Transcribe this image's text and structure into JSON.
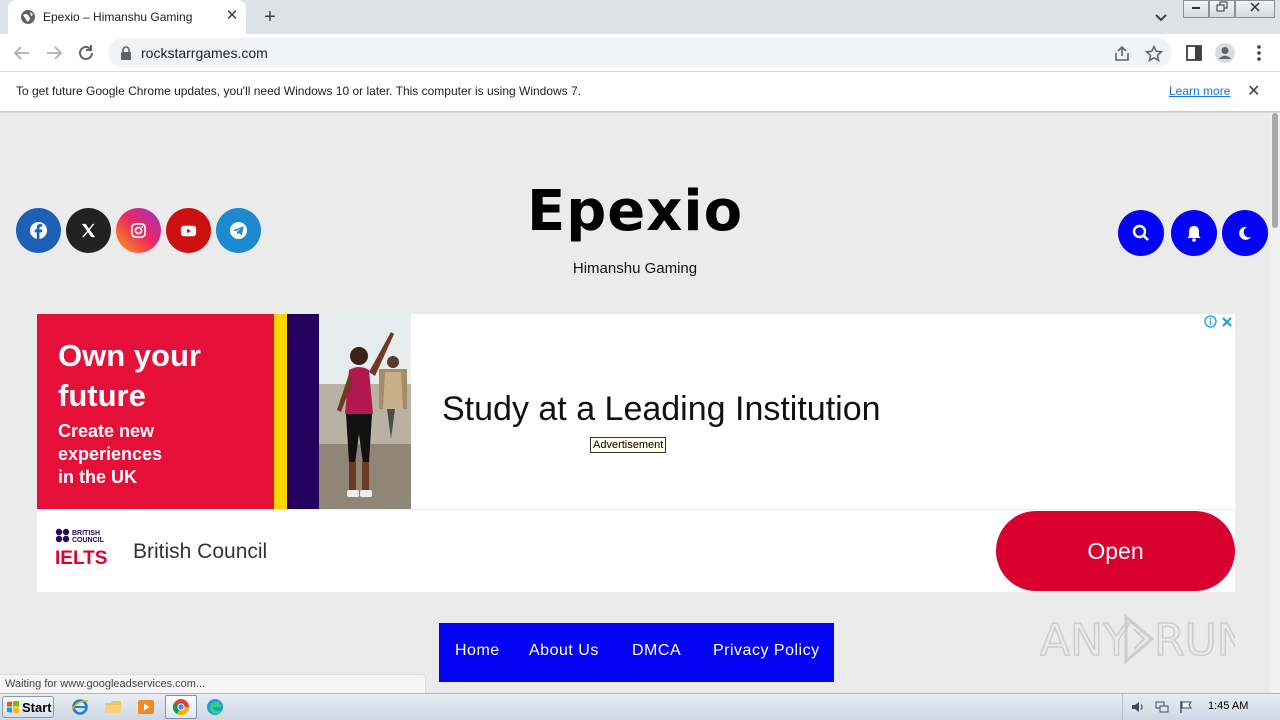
{
  "browser": {
    "tab_title": "Epexio – Himanshu Gaming",
    "tab_close": "✕",
    "new_tab": "+",
    "url": "rockstarrgames.com"
  },
  "infobar": {
    "message": "To get future Google Chrome updates, you'll need Windows 10 or later. This computer is using Windows 7.",
    "learn_more": "Learn more",
    "close": "✕"
  },
  "site": {
    "title": "Epexio",
    "subtitle": "Himanshu Gaming",
    "social_icons": [
      "facebook-icon",
      "x-icon",
      "instagram-icon",
      "youtube-icon",
      "telegram-icon"
    ],
    "colors": {
      "accent": "#0404f4",
      "facebook": "#1f60b6",
      "x": "#222222",
      "youtube": "#cc1010",
      "telegram": "#1b8ad1"
    }
  },
  "ad": {
    "line1": "Own your",
    "line2": "future",
    "sub1": "Create new",
    "sub2": "experiences",
    "sub3": "in the UK",
    "headline": "Study at a Leading Institution",
    "label": "Advertisement",
    "advertiser": "British Council",
    "logo_top": "BRITISH",
    "logo_mid": "COUNCIL",
    "logo_bottom": "IELTS",
    "cta": "Open",
    "colors": {
      "red": "#e60f37",
      "yellow": "#ffd600",
      "purple": "#23005c",
      "cta": "#d9002f"
    }
  },
  "menu": {
    "items": [
      "Home",
      "About Us",
      "DMCA",
      "Privacy Policy"
    ]
  },
  "status_text": "Waiting for www.googleadservices.com...",
  "watermark": "ANY RUN",
  "taskbar": {
    "start": "Start",
    "clock": "1:45 AM"
  }
}
